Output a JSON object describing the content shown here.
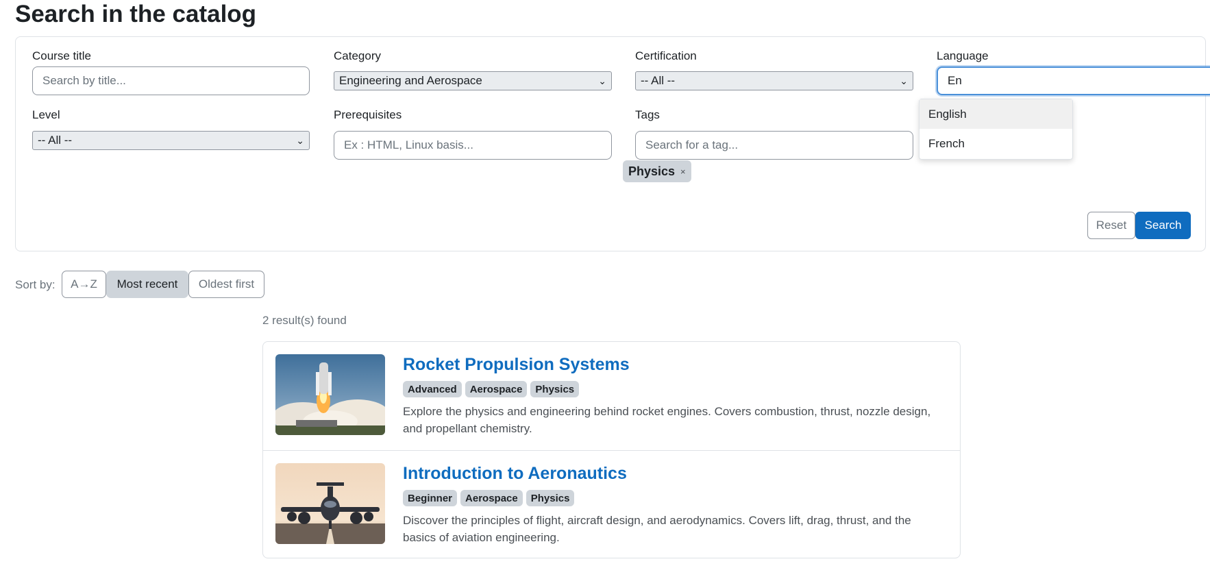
{
  "page": {
    "title": "Search in the catalog"
  },
  "filters": {
    "course_title": {
      "label": "Course title",
      "placeholder": "Search by title..."
    },
    "category": {
      "label": "Category",
      "selected": "Engineering and Aerospace"
    },
    "certification": {
      "label": "Certification",
      "selected": "-- All --"
    },
    "language": {
      "label": "Language",
      "value": "En",
      "suggestions": [
        "English",
        "French"
      ]
    },
    "level": {
      "label": "Level",
      "selected": "-- All --"
    },
    "prerequisites": {
      "label": "Prerequisites",
      "placeholder": "Ex : HTML, Linux basis..."
    },
    "tags": {
      "label": "Tags",
      "placeholder": "Search for a tag...",
      "selected": [
        "Physics"
      ],
      "remove_symbol": "×"
    },
    "reset_label": "Reset",
    "search_label": "Search"
  },
  "sort": {
    "label": "Sort by:",
    "options": [
      "A→Z",
      "Most recent",
      "Oldest first"
    ],
    "active": "Most recent"
  },
  "results": {
    "count_text": "2 result(s) found",
    "items": [
      {
        "title": "Rocket Propulsion Systems",
        "badges": [
          "Advanced",
          "Aerospace",
          "Physics"
        ],
        "description": "Explore the physics and engineering behind rocket engines. Covers combustion, thrust, nozzle design, and propellant chemistry.",
        "image": "rocket-launch"
      },
      {
        "title": "Introduction to Aeronautics",
        "badges": [
          "Beginner",
          "Aerospace",
          "Physics"
        ],
        "description": "Discover the principles of flight, aircraft design, and aerodynamics. Covers lift, drag, thrust, and the basics of aviation engineering.",
        "image": "airplane-runway"
      }
    ]
  },
  "colors": {
    "primary": "#0f6cbf",
    "badge_bg": "#ced4da",
    "focus_ring": "#4a90d9",
    "muted_text": "#6a737b"
  }
}
